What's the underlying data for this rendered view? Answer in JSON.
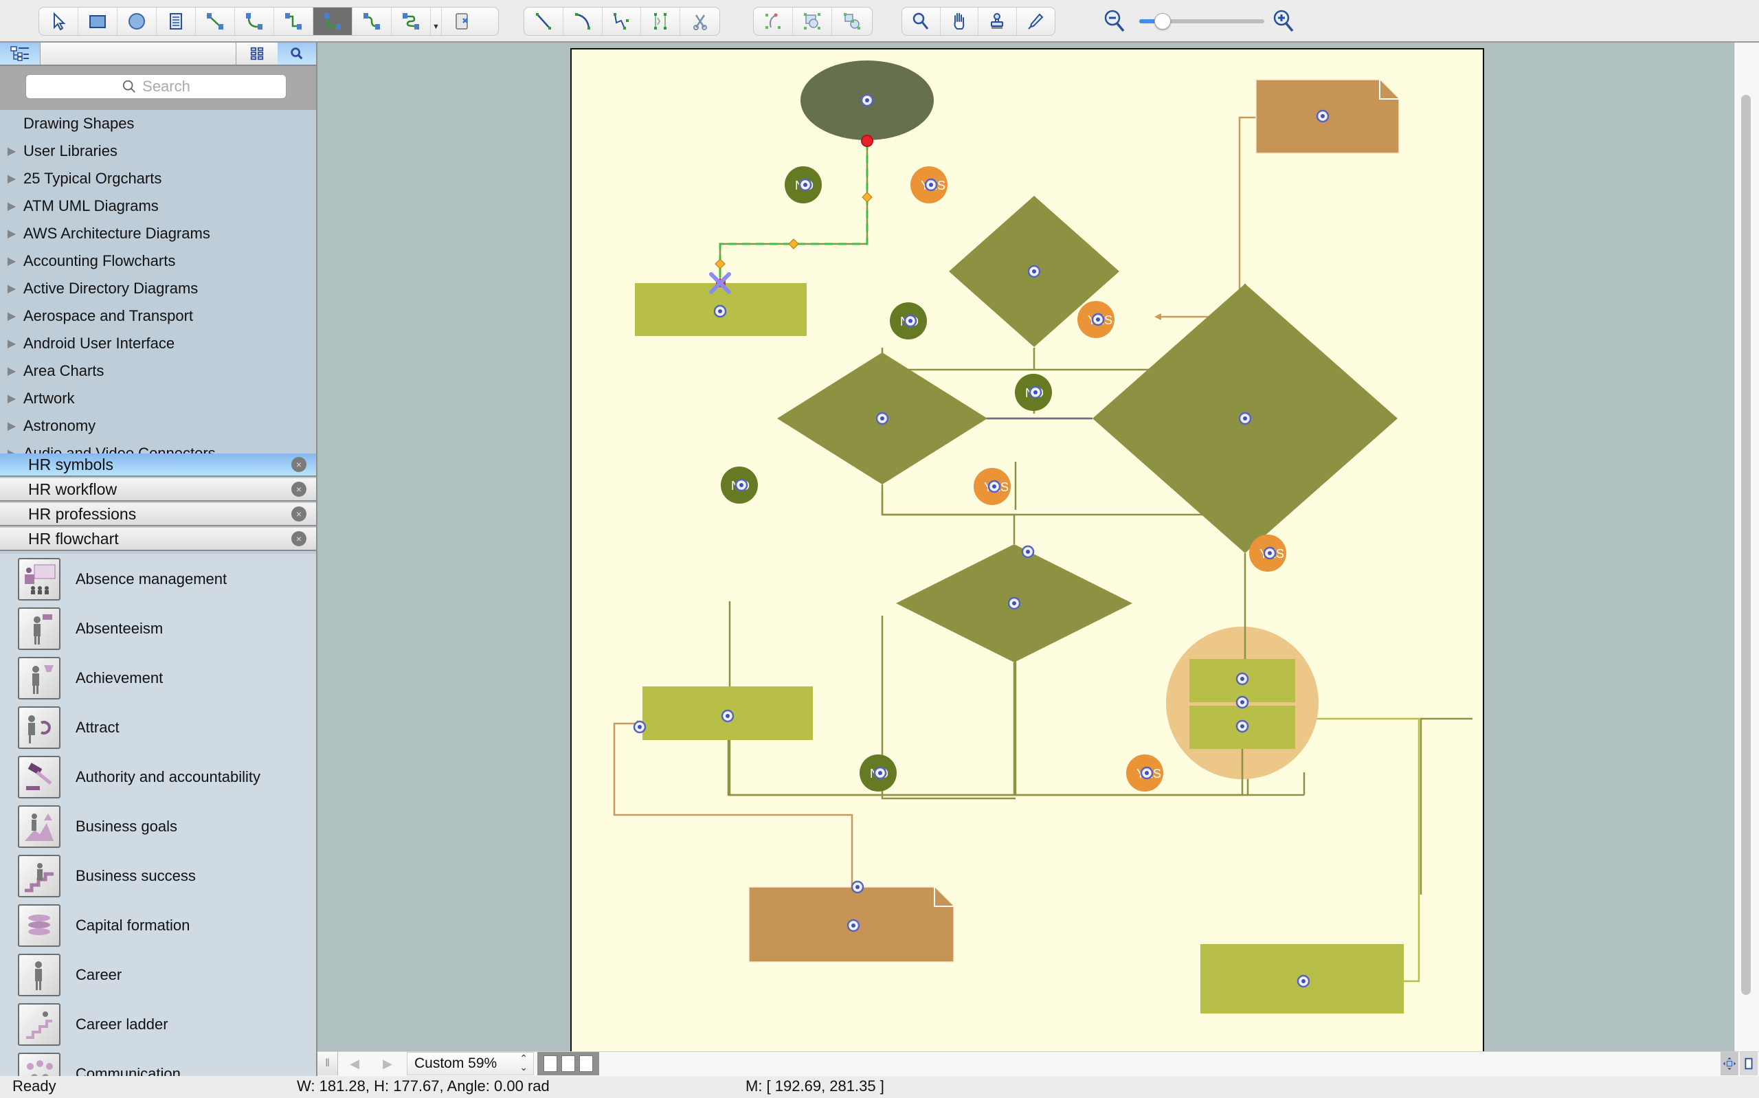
{
  "toolbar": {
    "group1": [
      {
        "name": "pointer-tool-button",
        "icon": "pointer-icon",
        "active": false
      },
      {
        "name": "rectangle-tool-button",
        "icon": "rectangle-icon",
        "active": false
      },
      {
        "name": "ellipse-tool-button",
        "icon": "ellipse-icon",
        "active": false
      },
      {
        "name": "text-tool-button",
        "icon": "text-block-icon",
        "active": false
      },
      {
        "name": "direct-connector-button",
        "icon": "direct-connector-icon",
        "active": false
      },
      {
        "name": "arc-connector-button",
        "icon": "arc-connector-icon",
        "active": false
      },
      {
        "name": "smart-connector-button",
        "icon": "smart-connector-icon",
        "active": false
      },
      {
        "name": "orthogonal-connector-button",
        "icon": "orthogonal-connector-icon",
        "active": true
      },
      {
        "name": "curved-connector-button",
        "icon": "curved-connector-icon",
        "active": false
      },
      {
        "name": "round-connector-button",
        "icon": "round-connector-icon",
        "active": false
      }
    ],
    "group1_extra": {
      "name": "insert-object-button",
      "icon": "insert-object-icon"
    },
    "group2": [
      {
        "name": "line-tool-button",
        "icon": "line-icon"
      },
      {
        "name": "arc-tool-button",
        "icon": "arc-icon"
      },
      {
        "name": "bezier-tool-button",
        "icon": "bezier-icon"
      },
      {
        "name": "polyline-tool-button",
        "icon": "polyline-icon"
      },
      {
        "name": "scissors-tool-button",
        "icon": "scissors-icon"
      }
    ],
    "group3": [
      {
        "name": "rotate-button",
        "icon": "rotate-icon"
      },
      {
        "name": "group-button",
        "icon": "group-icon"
      },
      {
        "name": "ungroup-button",
        "icon": "ungroup-icon"
      }
    ],
    "group4": [
      {
        "name": "zoom-tool-button",
        "icon": "magnifier-icon"
      },
      {
        "name": "pan-tool-button",
        "icon": "hand-icon"
      },
      {
        "name": "stamp-tool-button",
        "icon": "stamp-icon"
      },
      {
        "name": "eyedropper-tool-button",
        "icon": "eyedropper-icon"
      }
    ],
    "zoom_slider_value_percent": 59
  },
  "left_panel": {
    "tabs": [
      {
        "name": "tree-view-tab",
        "icon": "tree-view-icon"
      },
      {
        "name": "grid-view-tab",
        "icon": "grid-view-icon"
      },
      {
        "name": "search-tab",
        "icon": "search-icon"
      }
    ],
    "search_placeholder": "Search",
    "library_tree": [
      {
        "label": "Drawing Shapes",
        "expandable": false
      },
      {
        "label": "User Libraries",
        "expandable": true
      },
      {
        "label": "25 Typical Orgcharts",
        "expandable": true
      },
      {
        "label": "ATM UML Diagrams",
        "expandable": true
      },
      {
        "label": "AWS Architecture Diagrams",
        "expandable": true
      },
      {
        "label": "Accounting Flowcharts",
        "expandable": true
      },
      {
        "label": "Active Directory Diagrams",
        "expandable": true
      },
      {
        "label": "Aerospace and Transport",
        "expandable": true
      },
      {
        "label": "Android User Interface",
        "expandable": true
      },
      {
        "label": "Area Charts",
        "expandable": true
      },
      {
        "label": "Artwork",
        "expandable": true
      },
      {
        "label": "Astronomy",
        "expandable": true
      },
      {
        "label": "Audio and Video Connectors",
        "expandable": true
      }
    ],
    "open_libraries": [
      {
        "label": "HR symbols",
        "selected": true
      },
      {
        "label": "HR workflow",
        "selected": false
      },
      {
        "label": "HR professions",
        "selected": false
      },
      {
        "label": "HR flowchart",
        "selected": false
      }
    ],
    "shapes": [
      {
        "label": "Absence management",
        "icon": "absence-management-icon"
      },
      {
        "label": "Absenteeism",
        "icon": "absenteeism-icon"
      },
      {
        "label": "Achievement",
        "icon": "achievement-icon"
      },
      {
        "label": "Attract",
        "icon": "attract-icon"
      },
      {
        "label": "Authority and accountability",
        "icon": "gavel-icon"
      },
      {
        "label": "Business goals",
        "icon": "business-goals-icon"
      },
      {
        "label": "Business success",
        "icon": "business-success-icon"
      },
      {
        "label": "Capital formation",
        "icon": "capital-formation-icon"
      },
      {
        "label": "Career",
        "icon": "career-icon"
      },
      {
        "label": "Career ladder",
        "icon": "career-ladder-icon"
      },
      {
        "label": "Communication",
        "icon": "communication-icon"
      }
    ]
  },
  "diagram": {
    "colors": {
      "page_bg": "#fefde0",
      "terminator": "#66704c",
      "decision": "#8d9242",
      "process": "#b7bf48",
      "document": "#c69455",
      "no_badge": "#657a22",
      "yes_badge": "#ea9437",
      "group_circle": "#ecc788",
      "connector": "#8d9242",
      "connector_doc": "#c99a5a",
      "selected_connector": "#3ec03e"
    },
    "badges": {
      "no_label": "NO",
      "yes_label": "YES"
    }
  },
  "bottom_bar": {
    "zoom_label": "Custom 59%"
  },
  "status": {
    "state": "Ready",
    "dimensions": "W: 181.28,  H: 177.67,  Angle: 0.00 rad",
    "mouse": "M: [ 192.69, 281.35 ]"
  }
}
